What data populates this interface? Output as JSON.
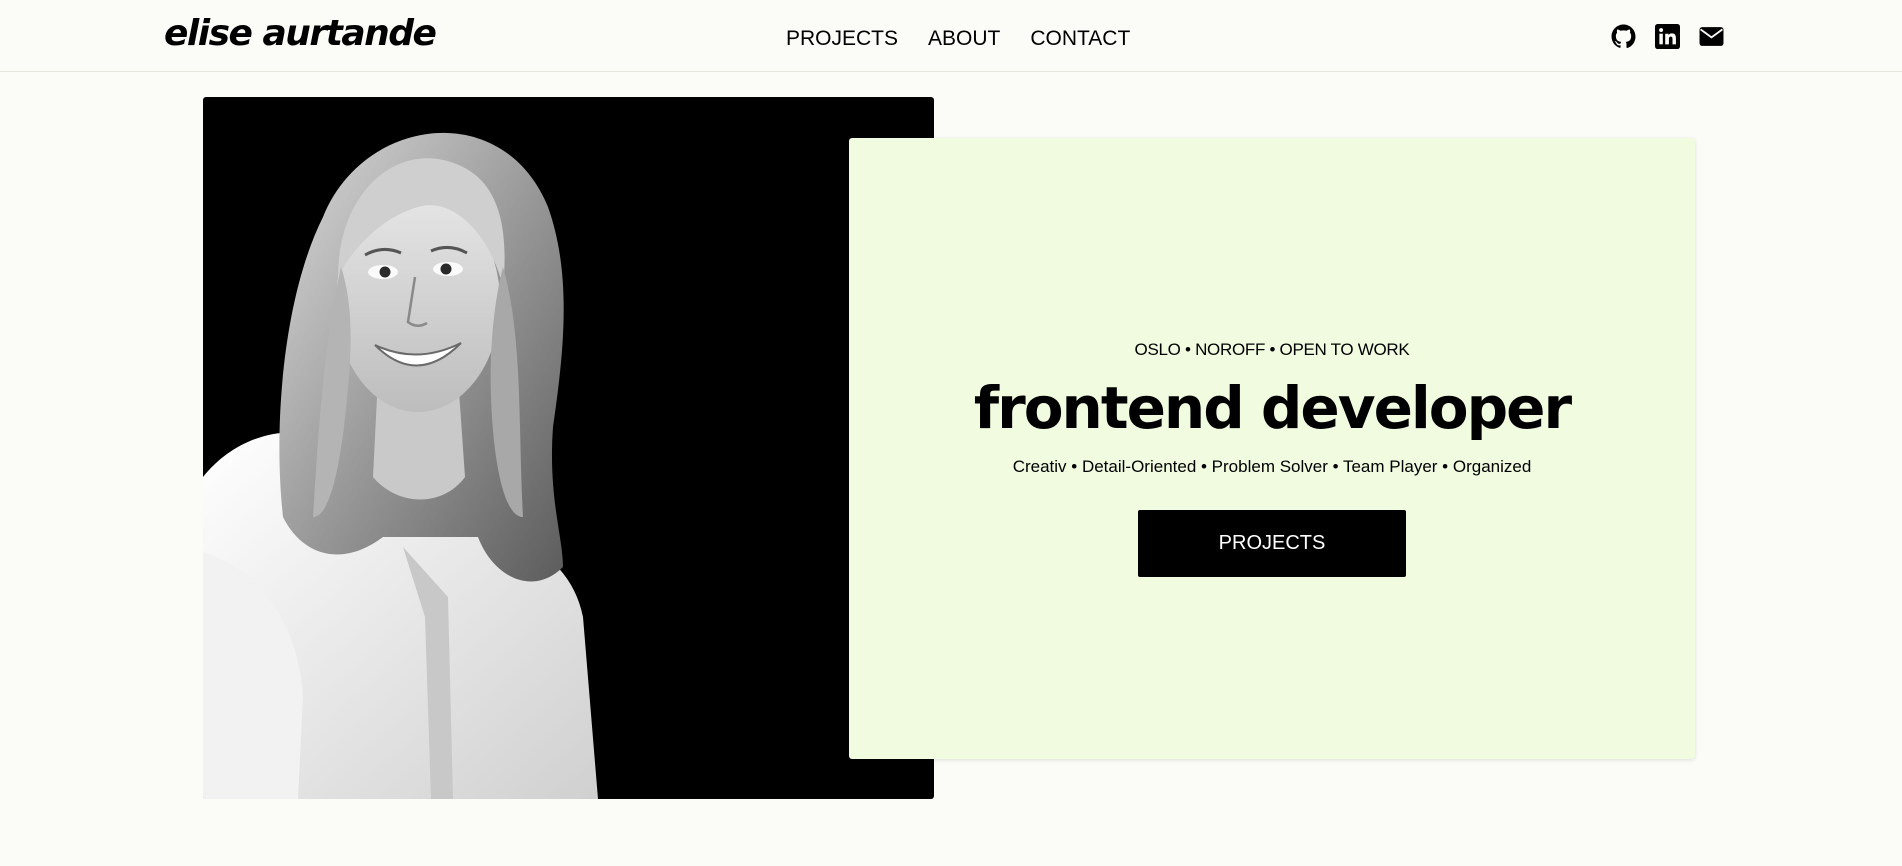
{
  "header": {
    "logo": "elise aurtande",
    "nav": [
      {
        "label": "PROJECTS"
      },
      {
        "label": "ABOUT"
      },
      {
        "label": "CONTACT"
      }
    ],
    "socials": [
      {
        "icon": "github-icon"
      },
      {
        "icon": "linkedin-icon"
      },
      {
        "icon": "mail-icon"
      }
    ]
  },
  "hero": {
    "tagline": "OSLO • NOROFF • OPEN TO WORK",
    "title": "frontend developer",
    "traits": "Creativ • Detail-Oriented • Problem Solver • Team Player • Organized",
    "cta_label": "PROJECTS"
  },
  "colors": {
    "page_background": "#fbfcf7",
    "card_background": "#f0fbe0",
    "photo_background": "#000000",
    "button_background": "#000000",
    "button_text": "#ffffff"
  }
}
